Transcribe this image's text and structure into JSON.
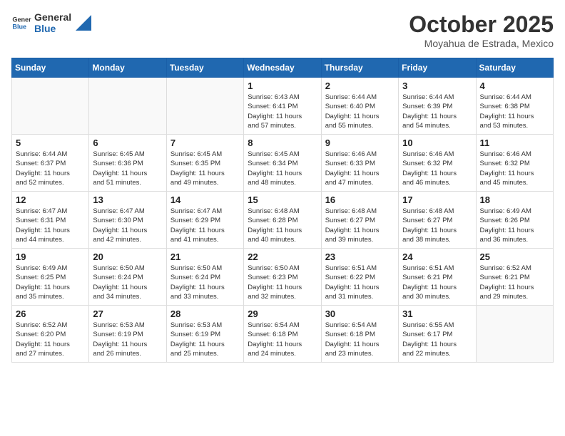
{
  "logo": {
    "line1": "General",
    "line2": "Blue"
  },
  "title": "October 2025",
  "subtitle": "Moyahua de Estrada, Mexico",
  "days_of_week": [
    "Sunday",
    "Monday",
    "Tuesday",
    "Wednesday",
    "Thursday",
    "Friday",
    "Saturday"
  ],
  "weeks": [
    [
      {
        "day": "",
        "info": ""
      },
      {
        "day": "",
        "info": ""
      },
      {
        "day": "",
        "info": ""
      },
      {
        "day": "1",
        "info": "Sunrise: 6:43 AM\nSunset: 6:41 PM\nDaylight: 11 hours\nand 57 minutes."
      },
      {
        "day": "2",
        "info": "Sunrise: 6:44 AM\nSunset: 6:40 PM\nDaylight: 11 hours\nand 55 minutes."
      },
      {
        "day": "3",
        "info": "Sunrise: 6:44 AM\nSunset: 6:39 PM\nDaylight: 11 hours\nand 54 minutes."
      },
      {
        "day": "4",
        "info": "Sunrise: 6:44 AM\nSunset: 6:38 PM\nDaylight: 11 hours\nand 53 minutes."
      }
    ],
    [
      {
        "day": "5",
        "info": "Sunrise: 6:44 AM\nSunset: 6:37 PM\nDaylight: 11 hours\nand 52 minutes."
      },
      {
        "day": "6",
        "info": "Sunrise: 6:45 AM\nSunset: 6:36 PM\nDaylight: 11 hours\nand 51 minutes."
      },
      {
        "day": "7",
        "info": "Sunrise: 6:45 AM\nSunset: 6:35 PM\nDaylight: 11 hours\nand 49 minutes."
      },
      {
        "day": "8",
        "info": "Sunrise: 6:45 AM\nSunset: 6:34 PM\nDaylight: 11 hours\nand 48 minutes."
      },
      {
        "day": "9",
        "info": "Sunrise: 6:46 AM\nSunset: 6:33 PM\nDaylight: 11 hours\nand 47 minutes."
      },
      {
        "day": "10",
        "info": "Sunrise: 6:46 AM\nSunset: 6:32 PM\nDaylight: 11 hours\nand 46 minutes."
      },
      {
        "day": "11",
        "info": "Sunrise: 6:46 AM\nSunset: 6:32 PM\nDaylight: 11 hours\nand 45 minutes."
      }
    ],
    [
      {
        "day": "12",
        "info": "Sunrise: 6:47 AM\nSunset: 6:31 PM\nDaylight: 11 hours\nand 44 minutes."
      },
      {
        "day": "13",
        "info": "Sunrise: 6:47 AM\nSunset: 6:30 PM\nDaylight: 11 hours\nand 42 minutes."
      },
      {
        "day": "14",
        "info": "Sunrise: 6:47 AM\nSunset: 6:29 PM\nDaylight: 11 hours\nand 41 minutes."
      },
      {
        "day": "15",
        "info": "Sunrise: 6:48 AM\nSunset: 6:28 PM\nDaylight: 11 hours\nand 40 minutes."
      },
      {
        "day": "16",
        "info": "Sunrise: 6:48 AM\nSunset: 6:27 PM\nDaylight: 11 hours\nand 39 minutes."
      },
      {
        "day": "17",
        "info": "Sunrise: 6:48 AM\nSunset: 6:27 PM\nDaylight: 11 hours\nand 38 minutes."
      },
      {
        "day": "18",
        "info": "Sunrise: 6:49 AM\nSunset: 6:26 PM\nDaylight: 11 hours\nand 36 minutes."
      }
    ],
    [
      {
        "day": "19",
        "info": "Sunrise: 6:49 AM\nSunset: 6:25 PM\nDaylight: 11 hours\nand 35 minutes."
      },
      {
        "day": "20",
        "info": "Sunrise: 6:50 AM\nSunset: 6:24 PM\nDaylight: 11 hours\nand 34 minutes."
      },
      {
        "day": "21",
        "info": "Sunrise: 6:50 AM\nSunset: 6:24 PM\nDaylight: 11 hours\nand 33 minutes."
      },
      {
        "day": "22",
        "info": "Sunrise: 6:50 AM\nSunset: 6:23 PM\nDaylight: 11 hours\nand 32 minutes."
      },
      {
        "day": "23",
        "info": "Sunrise: 6:51 AM\nSunset: 6:22 PM\nDaylight: 11 hours\nand 31 minutes."
      },
      {
        "day": "24",
        "info": "Sunrise: 6:51 AM\nSunset: 6:21 PM\nDaylight: 11 hours\nand 30 minutes."
      },
      {
        "day": "25",
        "info": "Sunrise: 6:52 AM\nSunset: 6:21 PM\nDaylight: 11 hours\nand 29 minutes."
      }
    ],
    [
      {
        "day": "26",
        "info": "Sunrise: 6:52 AM\nSunset: 6:20 PM\nDaylight: 11 hours\nand 27 minutes."
      },
      {
        "day": "27",
        "info": "Sunrise: 6:53 AM\nSunset: 6:19 PM\nDaylight: 11 hours\nand 26 minutes."
      },
      {
        "day": "28",
        "info": "Sunrise: 6:53 AM\nSunset: 6:19 PM\nDaylight: 11 hours\nand 25 minutes."
      },
      {
        "day": "29",
        "info": "Sunrise: 6:54 AM\nSunset: 6:18 PM\nDaylight: 11 hours\nand 24 minutes."
      },
      {
        "day": "30",
        "info": "Sunrise: 6:54 AM\nSunset: 6:18 PM\nDaylight: 11 hours\nand 23 minutes."
      },
      {
        "day": "31",
        "info": "Sunrise: 6:55 AM\nSunset: 6:17 PM\nDaylight: 11 hours\nand 22 minutes."
      },
      {
        "day": "",
        "info": ""
      }
    ]
  ]
}
